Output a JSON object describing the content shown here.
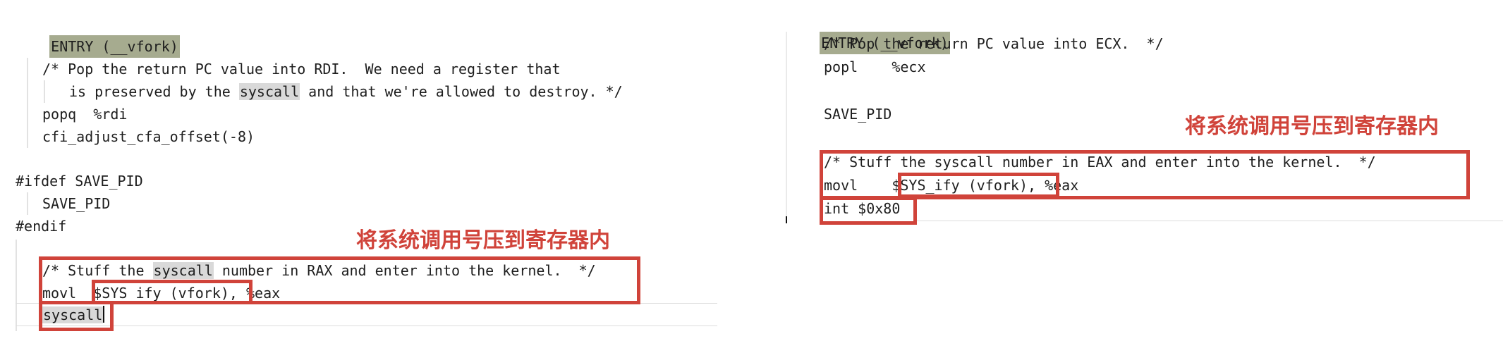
{
  "left_panel": {
    "entry_line": "ENTRY (__vfork)",
    "comment_line1": "/* Pop the return PC value into RDI.  We need a register that",
    "comment_line2_pre": "is preserved by the ",
    "comment_line2_hl": "syscall",
    "comment_line2_post": " and that we're allowed to destroy. */",
    "popq_line": "popq  %rdi",
    "cfi_line": "cfi_adjust_cfa_offset(-8)",
    "ifdef_line": "#ifdef SAVE_PID",
    "save_pid_line": "SAVE_PID",
    "endif_line": "#endif",
    "annotation": "将系统调用号压到寄存器内",
    "stuff_pre": "/* Stuff the ",
    "stuff_hl": "syscall",
    "stuff_post": " number in RAX and enter into the kernel.  */",
    "movl_op": "movl  ",
    "movl_arg": "$SYS_ify (vfork),",
    "movl_rest": " %eax",
    "syscall_line": "syscall"
  },
  "right_panel": {
    "entry_line": "ENTRY (__vfork)",
    "comment_line": "/* Pop the return PC value into ECX.  */",
    "popl_line": "popl    %ecx",
    "save_pid_line": "SAVE_PID",
    "annotation": "将系统调用号压到寄存器内",
    "stuff_line": "/* Stuff the syscall number in EAX and enter into the kernel.  */",
    "movl_op": "movl    ",
    "movl_arg": "$SYS_ify (vfork),",
    "movl_rest": " %eax",
    "int_line": "int $0x80"
  },
  "colors": {
    "annotation_red": "#d0433a",
    "entry_highlight": "#a6ab8f",
    "word_highlight": "#d9d9d9"
  }
}
